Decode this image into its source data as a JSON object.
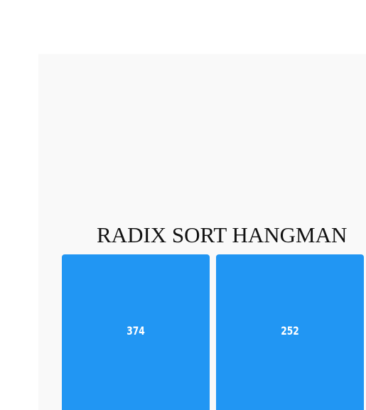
{
  "game": {
    "title": "RADIX SORT HANGMAN",
    "tiles": [
      {
        "value": "374"
      },
      {
        "value": "252"
      }
    ],
    "colors": {
      "tile": "#2196f3",
      "tile_text": "#ffffff",
      "panel": "#f9f9f9",
      "title_text": "#111111"
    }
  }
}
